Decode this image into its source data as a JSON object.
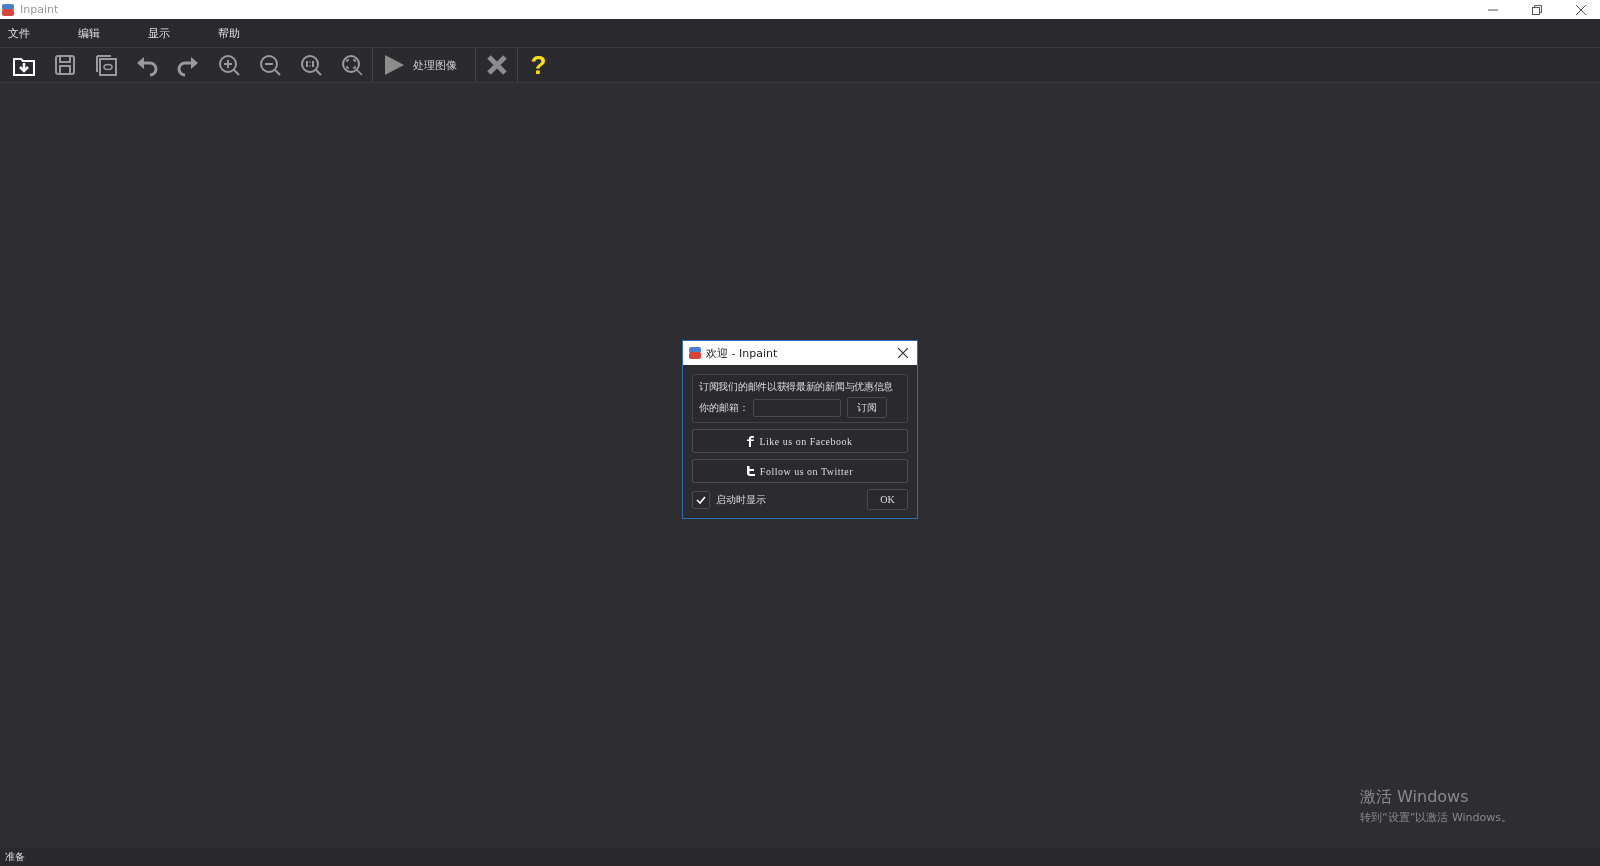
{
  "window": {
    "title": "Inpaint"
  },
  "menu": [
    {
      "label": "文件"
    },
    {
      "label": "编辑"
    },
    {
      "label": "显示"
    },
    {
      "label": "帮助"
    }
  ],
  "toolbar": {
    "process_button": {
      "label": "处理图像"
    },
    "help_button": {
      "label": "?"
    }
  },
  "dialog": {
    "title": "欢迎 - Inpaint",
    "message": "订阅我们的邮件以获得最新的新闻与优惠信息",
    "email_label": "你的邮箱：",
    "subscribe_button": "订阅",
    "facebook_button": "Like us on Facebook",
    "twitter_button": "Follow us on Twitter",
    "show_on_startup": {
      "label": "启动时显示",
      "checked": true
    },
    "ok_button": "OK"
  },
  "activation": {
    "title": "激活 Windows",
    "text": "转到“设置”以激活 Windows。"
  },
  "status_bar": {
    "text": "准备"
  }
}
